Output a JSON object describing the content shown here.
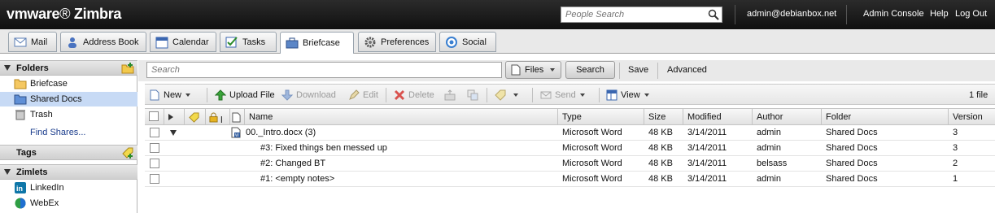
{
  "header": {
    "logo_vmware": "vmware",
    "logo_product": "Zimbra",
    "people_search_placeholder": "People Search",
    "user": "admin@debianbox.net",
    "links": [
      "Admin Console",
      "Help",
      "Log Out"
    ]
  },
  "app_tabs": [
    {
      "label": "Mail",
      "icon": "envelope-icon"
    },
    {
      "label": "Address Book",
      "icon": "contacts-icon"
    },
    {
      "label": "Calendar",
      "icon": "calendar-icon"
    },
    {
      "label": "Tasks",
      "icon": "checkbox-icon"
    },
    {
      "label": "Briefcase",
      "icon": "briefcase-icon",
      "active": true
    },
    {
      "label": "Preferences",
      "icon": "gear-icon"
    },
    {
      "label": "Social",
      "icon": "social-icon"
    }
  ],
  "sidebar": {
    "folders_title": "Folders",
    "folders": [
      {
        "label": "Briefcase",
        "icon": "folder-icon"
      },
      {
        "label": "Shared Docs",
        "icon": "shared-folder-icon",
        "selected": true
      },
      {
        "label": "Trash",
        "icon": "trash-icon"
      }
    ],
    "find_shares": "Find Shares...",
    "tags_title": "Tags",
    "zimlets_title": "Zimlets",
    "zimlets": [
      {
        "label": "LinkedIn",
        "icon": "linkedin-icon"
      },
      {
        "label": "WebEx",
        "icon": "webex-icon"
      }
    ]
  },
  "search": {
    "placeholder": "Search",
    "scope": "Files",
    "search_button": "Search",
    "save": "Save",
    "advanced": "Advanced"
  },
  "toolbar": {
    "new": "New",
    "upload": "Upload File",
    "download": "Download",
    "edit": "Edit",
    "delete": "Delete",
    "send": "Send",
    "view": "View",
    "count": "1 file"
  },
  "grid": {
    "columns": [
      "Name",
      "Type",
      "Size",
      "Modified",
      "Author",
      "Folder",
      "Version"
    ],
    "lock_header": "l",
    "rows": [
      {
        "name": "00._Intro.docx (3)",
        "type": "Microsoft Word",
        "size": "48 KB",
        "modified": "3/14/2011",
        "author": "admin",
        "folder": "Shared Docs",
        "version": "3",
        "parent": true
      },
      {
        "name": "#3: Fixed things ben messed up",
        "type": "Microsoft Word",
        "size": "48 KB",
        "modified": "3/14/2011",
        "author": "admin",
        "folder": "Shared Docs",
        "version": "3"
      },
      {
        "name": "#2: Changed BT",
        "type": "Microsoft Word",
        "size": "48 KB",
        "modified": "3/14/2011",
        "author": "belsass",
        "folder": "Shared Docs",
        "version": "2"
      },
      {
        "name": "#1: <empty notes>",
        "type": "Microsoft Word",
        "size": "48 KB",
        "modified": "3/14/2011",
        "author": "admin",
        "folder": "Shared Docs",
        "version": "1"
      }
    ]
  }
}
